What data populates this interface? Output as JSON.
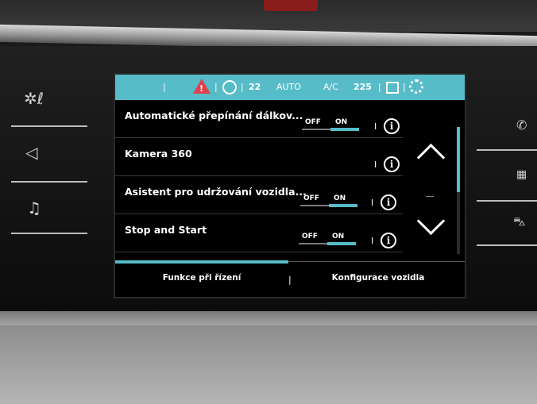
{
  "statusbar": {
    "warning_icon": "hazard-warning-icon",
    "fan_speed": "22",
    "mode": "AUTO",
    "ac_label": "A/C",
    "temperature": "22.5",
    "temperature_display": "225",
    "accent_color": "#56bcc8"
  },
  "settings": {
    "rows": [
      {
        "label": "Automatické přepínání dálkov...",
        "off": "OFF",
        "on": "ON",
        "state": "ON",
        "has_toggle": true
      },
      {
        "label": "Kamera 360",
        "has_toggle": false
      },
      {
        "label": "Asistent pro udržování vozidla...",
        "off": "OFF",
        "on": "ON",
        "state": "ON",
        "has_toggle": true
      },
      {
        "label": "Stop and Start",
        "off": "OFF",
        "on": "ON",
        "state": "ON",
        "has_toggle": true
      }
    ],
    "info_symbol": "i",
    "separator": "I"
  },
  "scroll": {
    "position_fraction": 0.5
  },
  "tabs": [
    {
      "label": "Funkce při řízení",
      "active": true
    },
    {
      "label": "Konfigurace vozidla",
      "active": false
    }
  ],
  "side_buttons": {
    "left": [
      "climate-icon",
      "navigation-icon",
      "music-icon"
    ],
    "right": [
      "phone-icon",
      "apps-icon",
      "car-icon"
    ]
  }
}
